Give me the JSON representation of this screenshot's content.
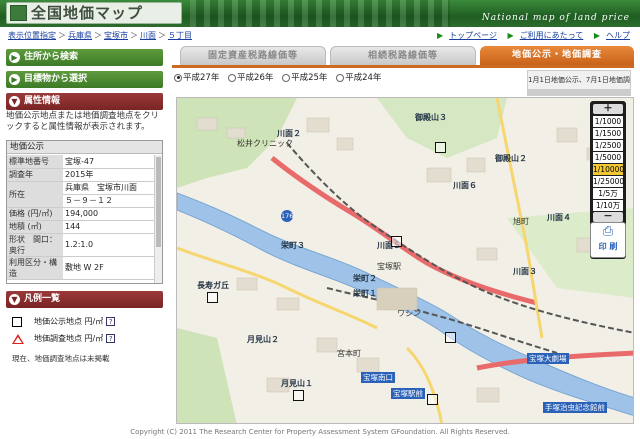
{
  "header": {
    "logo_text": "全国地価マップ",
    "tagline": "National map of land price"
  },
  "breadcrumb": {
    "items": [
      "表示位置指定",
      "兵庫県",
      "宝塚市",
      "川面",
      "５丁目"
    ],
    "separator": "＞"
  },
  "toplinks": {
    "top_page": "トップページ",
    "usage": "ご利用にあたって",
    "help": "ヘルプ"
  },
  "sidebar": {
    "address_search": "住所から検索",
    "landmark_select": "目標物から選択",
    "attr_info": "属性情報",
    "attr_desc": "地価公示地点または地価調査地点をクリックすると属性情報が表示されます。",
    "attr_table_title": "地価公示",
    "attr_rows": [
      {
        "k": "標準地番号",
        "v": "宝塚-47"
      },
      {
        "k": "調査年",
        "v": "2015年"
      },
      {
        "k": "所在",
        "v": "兵庫県　宝塚市川面"
      },
      {
        "k": "",
        "v": "５－９－１２"
      },
      {
        "k": "価格 (円/㎡)",
        "v": "194,000"
      },
      {
        "k": "地積 (㎡)",
        "v": "144"
      },
      {
        "k": "形状　間口：奥行",
        "v": "1.2:1.0"
      },
      {
        "k": "利用区分・構造",
        "v": "敷地 W 2F"
      }
    ],
    "legend_title": "凡例一覧",
    "legend_public": "地価公示地点 円/㎡",
    "legend_survey": "地価調査地点 円/㎡",
    "legend_note": "現在、地価調査地点は未掲載"
  },
  "tabs": {
    "fixed_asset": "固定資産税路線価等",
    "inheritance": "相続税路線価等",
    "public_price": "地価公示・地価調査"
  },
  "years": {
    "options": [
      "平成27年",
      "平成26年",
      "平成25年",
      "平成24年"
    ],
    "selected": "平成27年"
  },
  "date_note": "1月1日地価公示、7月1日地価調査",
  "map": {
    "labels": {
      "goten1": "御殿山１",
      "goten2": "御殿山２",
      "goten3": "御殿山３",
      "kawamo6": "川面６",
      "kawamo4": "川面４",
      "kawamo3": "川面３",
      "kawamo2": "川面２",
      "kawamo5": "川面５",
      "sakae3": "栄町３",
      "sakae2": "栄町２",
      "sakae1": "栄町１",
      "nagaooka": "長寿ガ丘",
      "tsukimiyama1": "月見山１",
      "tsukimiyama2": "月見山２",
      "asahicho": "旭町",
      "takarazuka_eki": "宝塚駅",
      "takarazuka_grand": "宝塚大劇場",
      "tezuka": "手塚治虫記念館前",
      "clinic": "松井クリニック",
      "route": "176",
      "nishi": "ワシン",
      "miyanishi": "宮本町",
      "marker_station1": "宝塚南口",
      "marker_station2": "宝塚駅前"
    }
  },
  "zoom": {
    "plus": "＋",
    "minus": "－",
    "levels": [
      "1/1000",
      "1/1500",
      "1/2500",
      "1/5000",
      "1/10000",
      "1/25000",
      "1/5万",
      "1/10万"
    ],
    "selected": "1/10000",
    "print_label": "印 刷"
  },
  "footer": "Copyright (C) 2011 The Research Center for Property Assessment System GFoundation. All Rights Reserved."
}
